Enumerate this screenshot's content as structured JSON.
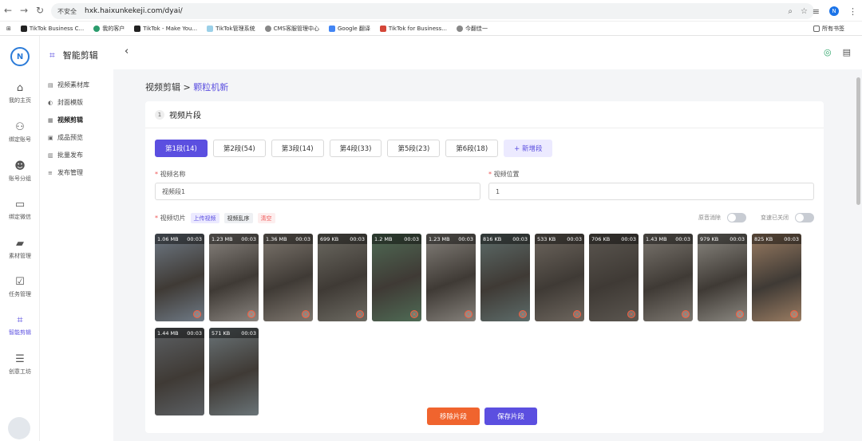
{
  "browser": {
    "security_label": "不安全",
    "url": "hxk.haixunkekeji.com/dyai/",
    "bookmarks": [
      "TikTok Business C...",
      "我的客户",
      "TikTok - Make You...",
      "TikTok管理系统",
      "CMS客服管理中心",
      "Google 翻译",
      "TikTok for Business...",
      "今翻佳一"
    ],
    "bookmarks_right": "所有书签",
    "avatar_letter": "N"
  },
  "rail": {
    "logo": "N",
    "items": [
      {
        "label": "我的主页",
        "icon": "home-icon"
      },
      {
        "label": "绑定账号",
        "icon": "user-add-icon"
      },
      {
        "label": "账号分组",
        "icon": "group-icon"
      },
      {
        "label": "绑定微信",
        "icon": "chat-icon"
      },
      {
        "label": "素材管理",
        "icon": "folder-icon"
      },
      {
        "label": "任务管理",
        "icon": "task-icon"
      },
      {
        "label": "智能剪辑",
        "icon": "crop-icon"
      },
      {
        "label": "创意工坊",
        "icon": "sliders-icon"
      }
    ],
    "active_index": 6
  },
  "sidebar": {
    "title": "智能剪辑",
    "items": [
      "视频素材库",
      "封面模版",
      "视频剪辑",
      "成品预览",
      "批量发布",
      "发布管理"
    ],
    "active_index": 2
  },
  "breadcrumb": {
    "parent": "视频剪辑",
    "separator": ">",
    "current": "颗粒机新"
  },
  "section": {
    "step": "1",
    "title": "视频片段"
  },
  "tabs": [
    "第1段(14)",
    "第2段(54)",
    "第3段(14)",
    "第4段(33)",
    "第5段(23)",
    "第6段(18)"
  ],
  "tab_add": "+ 新增段",
  "form": {
    "name_label": "视频名称",
    "name_value": "视频段1",
    "position_label": "视频位置",
    "position_value": "1",
    "required_mark": "*"
  },
  "clips": {
    "label": "视频切片",
    "upload": "上传视频",
    "shuffle": "视频乱序",
    "clear": "清空",
    "toggle1": "原音消除",
    "toggle2": "变速已关闭",
    "items": [
      {
        "size": "1.06 MB",
        "dur": "00:03",
        "color": "#6f7a86"
      },
      {
        "size": "1.23 MB",
        "dur": "00:03",
        "color": "#8a8580"
      },
      {
        "size": "1.36 MB",
        "dur": "00:03",
        "color": "#7e776f"
      },
      {
        "size": "699 KB",
        "dur": "00:03",
        "color": "#6c6a62"
      },
      {
        "size": "1.2 MB",
        "dur": "00:03",
        "color": "#4f6b55"
      },
      {
        "size": "1.23 MB",
        "dur": "00:03",
        "color": "#85817b"
      },
      {
        "size": "816 KB",
        "dur": "00:03",
        "color": "#5d6c6a"
      },
      {
        "size": "533 KB",
        "dur": "00:03",
        "color": "#6d665e"
      },
      {
        "size": "706 KB",
        "dur": "00:03",
        "color": "#5b5650"
      },
      {
        "size": "1.43 MB",
        "dur": "00:03",
        "color": "#7c7770"
      },
      {
        "size": "979 KB",
        "dur": "00:03",
        "color": "#8b8881"
      },
      {
        "size": "825 KB",
        "dur": "00:03",
        "color": "#9a7c62"
      },
      {
        "size": "1.44 MB",
        "dur": "00:03",
        "color": "#5c6064"
      },
      {
        "size": "571 KB",
        "dur": "00:03",
        "color": "#6a7478"
      }
    ]
  },
  "actions": {
    "remove": "移除片段",
    "save": "保存片段"
  }
}
